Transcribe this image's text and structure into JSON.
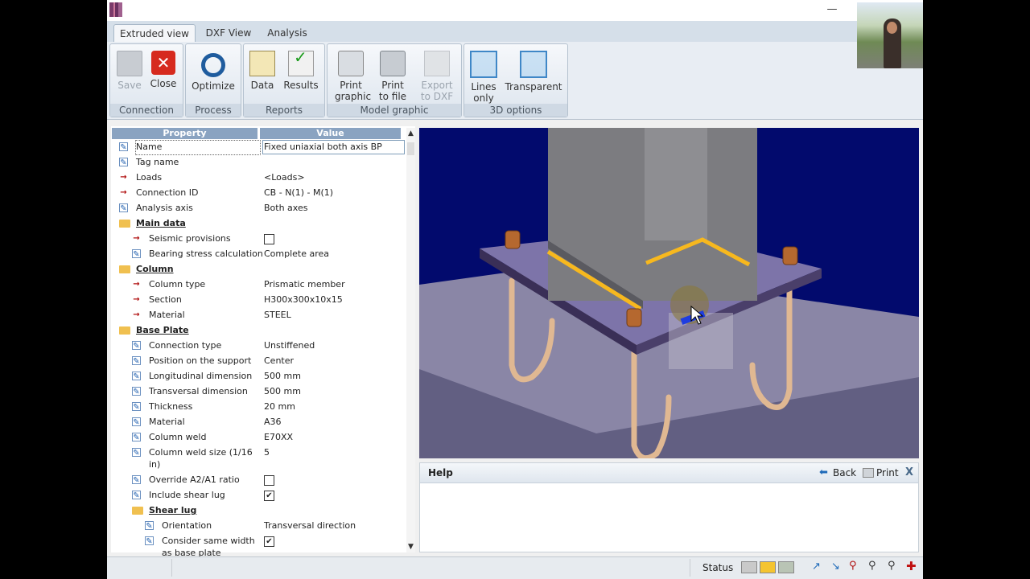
{
  "tabs": [
    "Extruded view",
    "DXF View",
    "Analysis"
  ],
  "ribbon": {
    "groups": [
      {
        "label": "Connection",
        "buttons": [
          {
            "label": "Save",
            "icon": "save-icon",
            "enabled": false
          },
          {
            "label": "Close",
            "icon": "close-icon",
            "enabled": true
          }
        ]
      },
      {
        "label": "Process",
        "buttons": [
          {
            "label": "Optimize",
            "icon": "optimize-icon",
            "enabled": true
          }
        ]
      },
      {
        "label": "Reports",
        "buttons": [
          {
            "label": "Data",
            "icon": "data-icon",
            "enabled": true
          },
          {
            "label": "Results",
            "icon": "results-icon",
            "enabled": true
          }
        ]
      },
      {
        "label": "Model graphic",
        "buttons": [
          {
            "label": "Print graphic",
            "icon": "printer-icon",
            "enabled": true
          },
          {
            "label": "Print to file",
            "icon": "print-to-file-icon",
            "enabled": true
          },
          {
            "label": "Export to DXF",
            "icon": "export-dxf-icon",
            "enabled": false
          }
        ]
      },
      {
        "label": "3D options",
        "buttons": [
          {
            "label": "Lines only",
            "icon": "wireframe-cube-icon",
            "enabled": true
          },
          {
            "label": "Transparent",
            "icon": "transparent-cube-icon",
            "enabled": true
          }
        ]
      }
    ]
  },
  "property_grid": {
    "headers": {
      "property": "Property",
      "value": "Value"
    },
    "rows": [
      {
        "name": "Name",
        "value": "Fixed uniaxial both axis BP",
        "icon": "edit",
        "level": 0
      },
      {
        "name": "Tag name",
        "value": "",
        "icon": "edit",
        "level": 0
      },
      {
        "name": "Loads",
        "value": "<Loads>",
        "icon": "link",
        "level": 0
      },
      {
        "name": "Connection ID",
        "value": "CB - N(1) - M(1)",
        "icon": "link",
        "level": 0
      },
      {
        "name": "Analysis axis",
        "value": "Both axes",
        "icon": "edit",
        "level": 0
      },
      {
        "name": "Main data",
        "value": "",
        "icon": "folder",
        "level": 0,
        "category": true
      },
      {
        "name": "Seismic provisions",
        "value": "",
        "checkbox": false,
        "icon": "link",
        "level": 1
      },
      {
        "name": "Bearing stress calculation",
        "value": "Complete area",
        "icon": "edit",
        "level": 1
      },
      {
        "name": "Column",
        "value": "",
        "icon": "folder",
        "level": 0,
        "category": true
      },
      {
        "name": "Column type",
        "value": "Prismatic member",
        "icon": "link",
        "level": 1
      },
      {
        "name": "Section",
        "value": "H300x300x10x15",
        "icon": "link",
        "level": 1
      },
      {
        "name": "Material",
        "value": "STEEL",
        "icon": "link",
        "level": 1
      },
      {
        "name": "Base Plate",
        "value": "",
        "icon": "folder",
        "level": 0,
        "category": true
      },
      {
        "name": "Connection type",
        "value": "Unstiffened",
        "icon": "edit",
        "level": 1
      },
      {
        "name": "Position on the support",
        "value": "Center",
        "icon": "edit",
        "level": 1
      },
      {
        "name": "Longitudinal dimension",
        "value": "500 mm",
        "icon": "edit",
        "level": 1
      },
      {
        "name": "Transversal dimension",
        "value": "500 mm",
        "icon": "edit",
        "level": 1
      },
      {
        "name": "Thickness",
        "value": "20 mm",
        "icon": "edit",
        "level": 1
      },
      {
        "name": "Material",
        "value": "A36",
        "icon": "edit",
        "level": 1
      },
      {
        "name": "Column weld",
        "value": "E70XX",
        "icon": "edit",
        "level": 1
      },
      {
        "name": "Column weld size (1/16",
        "name2": "in)",
        "value": "5",
        "icon": "edit",
        "level": 1,
        "tall": true
      },
      {
        "name": "Override A2/A1 ratio",
        "value": "",
        "checkbox": false,
        "icon": "edit",
        "level": 1
      },
      {
        "name": "Include shear lug",
        "value": "",
        "checkbox": true,
        "icon": "edit",
        "level": 1
      },
      {
        "name": "Shear lug",
        "value": "",
        "icon": "folder",
        "level": 1,
        "category": true
      },
      {
        "name": "Orientation",
        "value": "Transversal direction",
        "icon": "edit",
        "level": 2
      },
      {
        "name": "Consider same width",
        "name2": "as base plate",
        "value": "",
        "checkbox": true,
        "icon": "edit",
        "level": 2,
        "tall": true
      }
    ]
  },
  "help": {
    "title": "Help",
    "back_label": "Back",
    "print_label": "Print",
    "close_symbol": "X"
  },
  "statusbar": {
    "status_label": "Status"
  },
  "colors": {
    "viewport_bg": "#020a6d",
    "weld": "#f7b81e",
    "plate": "#7d74a9",
    "bolt": "#b5682f",
    "anchor": "#e0b892"
  }
}
